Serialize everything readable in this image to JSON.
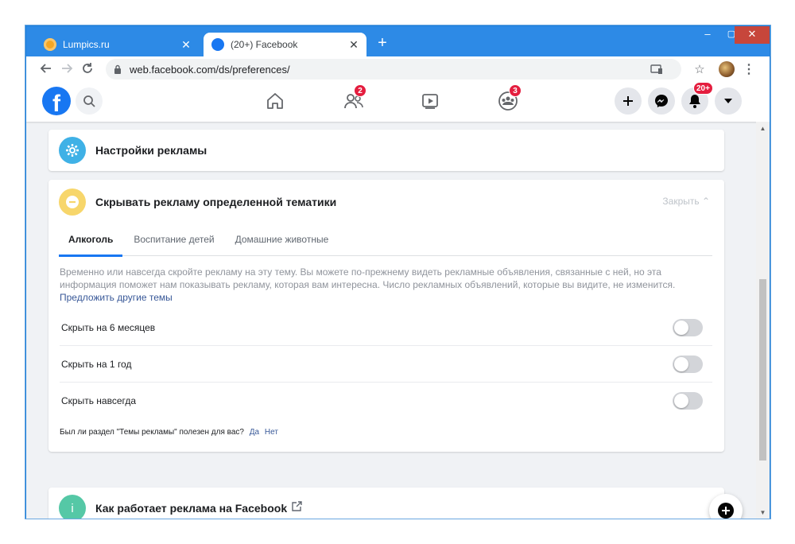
{
  "browser": {
    "tabs": [
      {
        "title": "Lumpics.ru",
        "close": "✕"
      },
      {
        "title": "(20+) Facebook",
        "close": "✕"
      }
    ],
    "new_tab": "+",
    "window_controls": {
      "minimize": "–",
      "maximize": "▢",
      "close": "✕"
    },
    "url": "web.facebook.com/ds/preferences/"
  },
  "fb_header": {
    "logo": "f",
    "badges": {
      "friends": "2",
      "groups": "3",
      "notifications": "20+"
    }
  },
  "ad_settings": {
    "title": "Настройки рекламы"
  },
  "hide_topics": {
    "title": "Скрывать рекламу определенной тематики",
    "close_label": "Закрыть ⌃",
    "tabs": [
      "Алкоголь",
      "Воспитание детей",
      "Домашние животные"
    ],
    "active_tab": "Алкоголь",
    "description": "Временно или навсегда скройте рекламу на эту тему. Вы можете по-прежнему видеть рекламные объявления, связанные с ней, но эта информация поможет нам показывать рекламу, которая вам интересна. Число рекламных объявлений, которые вы видите, не изменится.",
    "suggest_link": "Предложить другие темы",
    "options": [
      {
        "label": "Скрыть на 6 месяцев",
        "enabled": false
      },
      {
        "label": "Скрыть на 1 год",
        "enabled": false
      },
      {
        "label": "Скрыть навсегда",
        "enabled": false
      }
    ],
    "feedback": {
      "question": "Был ли раздел \"Темы рекламы\" полезен для вас?",
      "yes": "Да",
      "no": "Нет"
    }
  },
  "how_ads_work": {
    "icon_letter": "i",
    "title": "Как работает реклама на Facebook"
  },
  "colors": {
    "fb_blue": "#1877f2",
    "settings_icon": "#3fb1e6",
    "hide_icon": "#f7d66b",
    "info_icon": "#55c8a6",
    "badge_red": "#e41e3f",
    "chrome_blue": "#2d8ae6"
  }
}
